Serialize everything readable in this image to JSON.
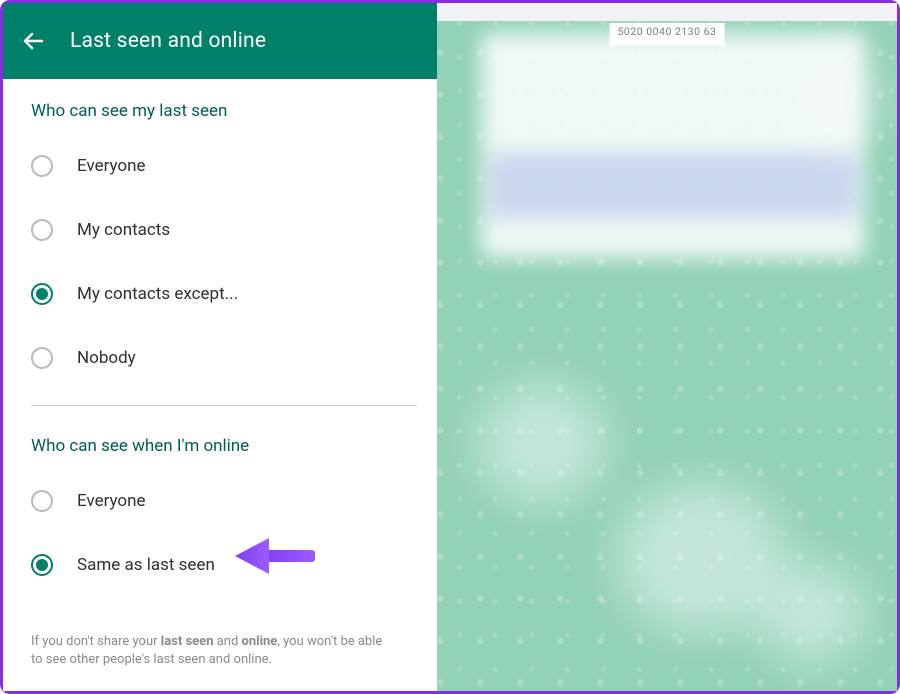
{
  "header": {
    "title": "Last seen and online"
  },
  "section1": {
    "title": "Who can see my last seen",
    "options": [
      {
        "label": "Everyone"
      },
      {
        "label": "My contacts"
      },
      {
        "label": "My contacts except..."
      },
      {
        "label": "Nobody"
      }
    ],
    "selected_index": 2
  },
  "section2": {
    "title": "Who can see when I'm online",
    "options": [
      {
        "label": "Everyone"
      },
      {
        "label": "Same as last seen"
      }
    ],
    "selected_index": 1
  },
  "footnote": {
    "pre": "If you don't share your ",
    "b1": "last seen",
    "mid": " and ",
    "b2": "online",
    "post": ", you won't be able to see other people's last seen and online."
  },
  "right_panel": {
    "top_code": "5020 0040 2130 63"
  }
}
